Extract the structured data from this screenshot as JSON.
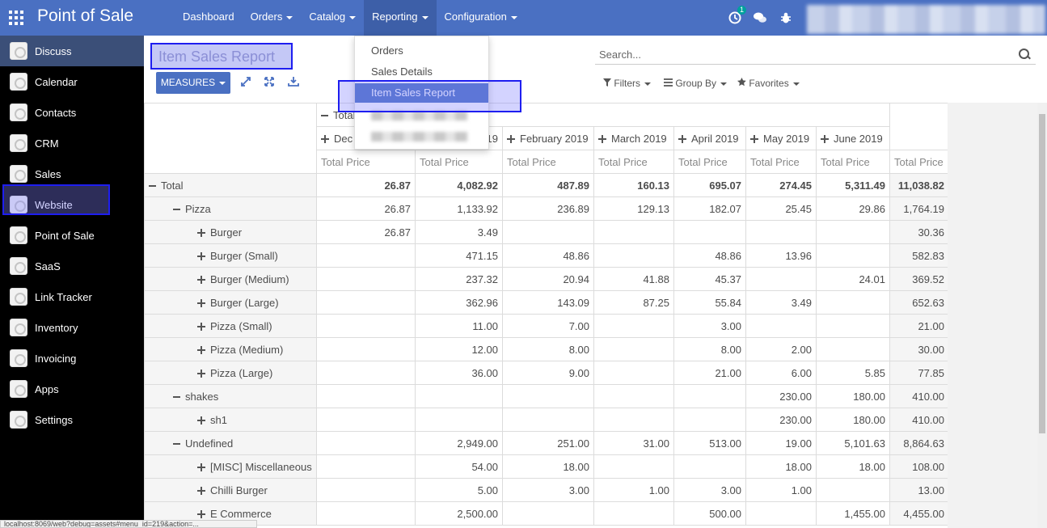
{
  "app": {
    "title": "Point of Sale"
  },
  "navbar": {
    "menu": [
      {
        "label": "Dashboard",
        "caret": false
      },
      {
        "label": "Orders",
        "caret": true
      },
      {
        "label": "Catalog",
        "caret": true
      },
      {
        "label": "Reporting",
        "caret": true,
        "active": true
      },
      {
        "label": "Configuration",
        "caret": true
      }
    ],
    "activity_badge": "1"
  },
  "reporting_menu": {
    "items": [
      "Orders",
      "Sales Details",
      "Item Sales Report"
    ],
    "selected": "Item Sales Report"
  },
  "sidebar": {
    "items": [
      "Discuss",
      "Calendar",
      "Contacts",
      "CRM",
      "Sales",
      "Website",
      "Point of Sale",
      "SaaS",
      "Link Tracker",
      "Inventory",
      "Invoicing",
      "Apps",
      "Settings"
    ],
    "active": "Point of Sale"
  },
  "page": {
    "title": "Item Sales Report",
    "measures_label": "MEASURES",
    "search_placeholder": "Search...",
    "filters_label": "Filters",
    "groupby_label": "Group By",
    "favorites_label": "Favorites"
  },
  "pivot": {
    "total_header": "Total",
    "months": [
      "Dec",
      "19",
      "February 2019",
      "March 2019",
      "April 2019",
      "May 2019",
      "June 2019"
    ],
    "measure": "Total Price",
    "rows": [
      {
        "label": "Total",
        "level": 0,
        "icon": "minus",
        "bold": true,
        "values": [
          "26.87",
          "4,082.92",
          "487.89",
          "160.13",
          "695.07",
          "274.45",
          "5,311.49"
        ],
        "total": "11,038.82"
      },
      {
        "label": "Pizza",
        "level": 1,
        "icon": "minus",
        "values": [
          "26.87",
          "1,133.92",
          "236.89",
          "129.13",
          "182.07",
          "25.45",
          "29.86"
        ],
        "total": "1,764.19"
      },
      {
        "label": "Burger",
        "level": 2,
        "icon": "plus",
        "values": [
          "26.87",
          "3.49",
          "",
          "",
          "",
          "",
          ""
        ],
        "total": "30.36"
      },
      {
        "label": "Burger (Small)",
        "level": 2,
        "icon": "plus",
        "values": [
          "",
          "471.15",
          "48.86",
          "",
          "48.86",
          "13.96",
          ""
        ],
        "total": "582.83"
      },
      {
        "label": "Burger (Medium)",
        "level": 2,
        "icon": "plus",
        "values": [
          "",
          "237.32",
          "20.94",
          "41.88",
          "45.37",
          "",
          "24.01"
        ],
        "total": "369.52"
      },
      {
        "label": "Burger (Large)",
        "level": 2,
        "icon": "plus",
        "values": [
          "",
          "362.96",
          "143.09",
          "87.25",
          "55.84",
          "3.49",
          ""
        ],
        "total": "652.63"
      },
      {
        "label": "Pizza (Small)",
        "level": 2,
        "icon": "plus",
        "values": [
          "",
          "11.00",
          "7.00",
          "",
          "3.00",
          "",
          ""
        ],
        "total": "21.00"
      },
      {
        "label": "Pizza (Medium)",
        "level": 2,
        "icon": "plus",
        "values": [
          "",
          "12.00",
          "8.00",
          "",
          "8.00",
          "2.00",
          ""
        ],
        "total": "30.00"
      },
      {
        "label": "Pizza (Large)",
        "level": 2,
        "icon": "plus",
        "values": [
          "",
          "36.00",
          "9.00",
          "",
          "21.00",
          "6.00",
          "5.85"
        ],
        "total": "77.85"
      },
      {
        "label": "shakes",
        "level": 1,
        "icon": "minus",
        "values": [
          "",
          "",
          "",
          "",
          "",
          "230.00",
          "180.00"
        ],
        "total": "410.00"
      },
      {
        "label": "sh1",
        "level": 2,
        "icon": "plus",
        "values": [
          "",
          "",
          "",
          "",
          "",
          "230.00",
          "180.00"
        ],
        "total": "410.00"
      },
      {
        "label": "Undefined",
        "level": 1,
        "icon": "minus",
        "values": [
          "",
          "2,949.00",
          "251.00",
          "31.00",
          "513.00",
          "19.00",
          "5,101.63"
        ],
        "total": "8,864.63"
      },
      {
        "label": "[MISC] Miscellaneous",
        "level": 2,
        "icon": "plus",
        "values": [
          "",
          "54.00",
          "18.00",
          "",
          "",
          "18.00",
          "18.00"
        ],
        "total": "108.00"
      },
      {
        "label": "Chilli Burger",
        "level": 2,
        "icon": "plus",
        "values": [
          "",
          "5.00",
          "3.00",
          "1.00",
          "3.00",
          "1.00",
          ""
        ],
        "total": "13.00"
      },
      {
        "label": "E Commerce",
        "level": 2,
        "icon": "plus",
        "values": [
          "",
          "2,500.00",
          "",
          "",
          "500.00",
          "",
          "1,455.00"
        ],
        "total": "4,455.00"
      }
    ]
  },
  "status_bar": {
    "text": "localhost:8069/web?debug=assets#menu_id=219&action=..."
  }
}
